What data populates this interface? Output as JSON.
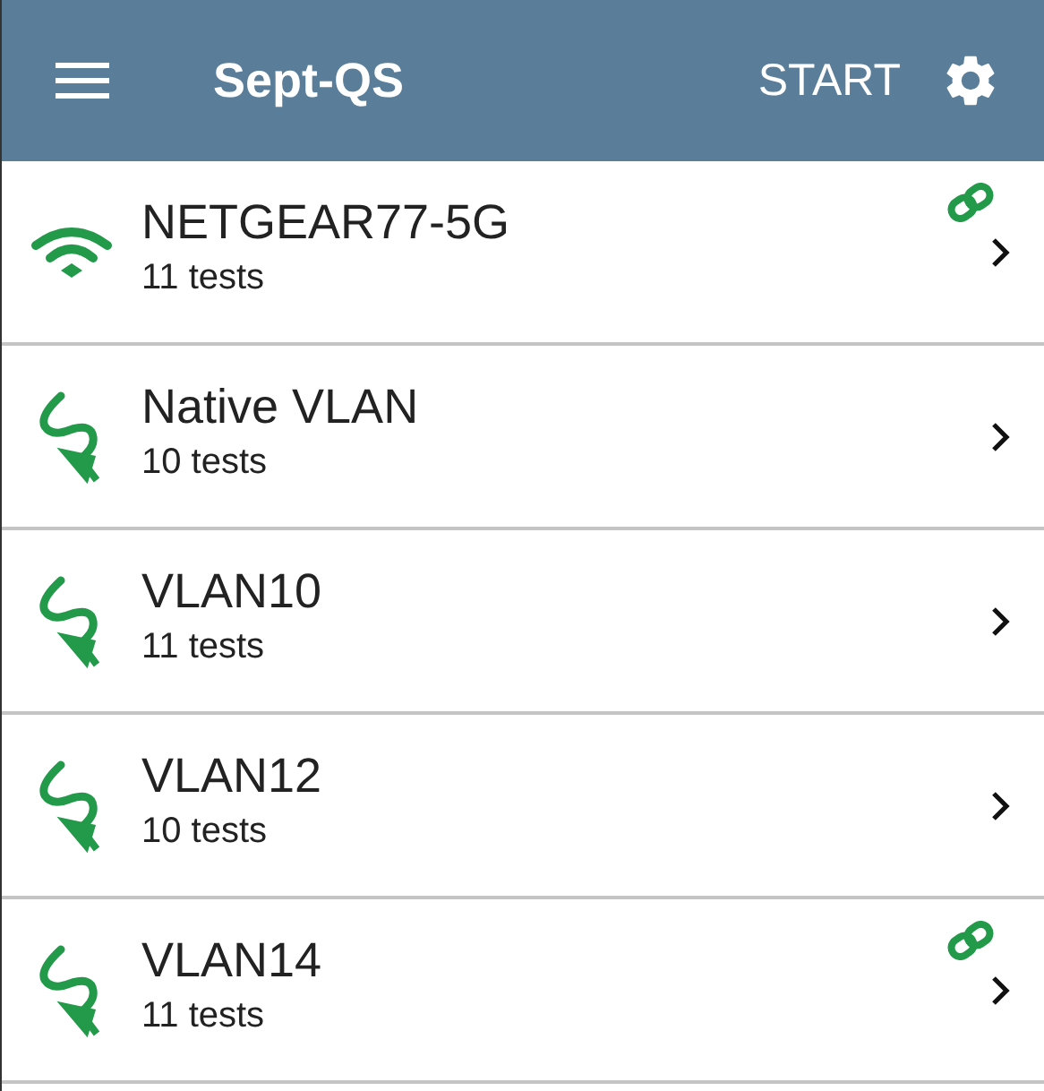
{
  "header": {
    "title": "Sept-QS",
    "action": "START"
  },
  "profiles": [
    {
      "kind": "wifi",
      "name": "NETGEAR77-5G",
      "detail": "11 tests",
      "linked": true
    },
    {
      "kind": "wired",
      "name": "Native VLAN",
      "detail": "10 tests",
      "linked": false
    },
    {
      "kind": "wired",
      "name": "VLAN10",
      "detail": "11 tests",
      "linked": false
    },
    {
      "kind": "wired",
      "name": "VLAN12",
      "detail": "10 tests",
      "linked": false
    },
    {
      "kind": "wired",
      "name": "VLAN14",
      "detail": "11 tests",
      "linked": true
    }
  ]
}
